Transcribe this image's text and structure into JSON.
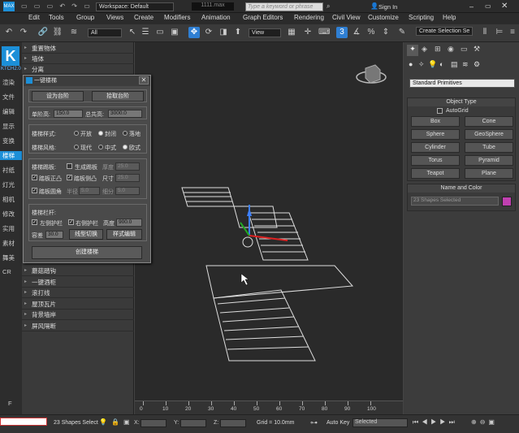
{
  "window": {
    "workspace": "Workspace: Default",
    "filename": "1111.max",
    "search_placeholder": "Type a keyword or phrase",
    "sign_in": "Sign In"
  },
  "menu": [
    "Edit",
    "Tools",
    "Group",
    "Views",
    "Create",
    "Modifiers",
    "Animation",
    "Graph Editors",
    "Rendering",
    "Civil View",
    "Customize",
    "Scripting",
    "Help"
  ],
  "toolbar": {
    "filter": "All",
    "view": "View",
    "selection_set": "Create Selection Se"
  },
  "left_nav": {
    "version": "KTCH2.0",
    "items": [
      "渲染",
      "文件",
      "编辑",
      "显示",
      "变换",
      "楼梯",
      "衬纸",
      "灯光",
      "相机",
      "修改",
      "实用",
      "素材",
      "舞美",
      "CR"
    ],
    "selected": "楼梯",
    "footer": "F"
  },
  "plugin_panel": {
    "top_items": [
      "重置物体",
      "墙体",
      "分离"
    ],
    "bottom_items": [
      "蘑菇踏钩",
      "一键酒柜",
      "滚打线",
      "屋顶瓦片",
      "背景墙岸",
      "屏风隔断"
    ]
  },
  "dialog": {
    "title": "一键楼梯",
    "btn_stairs": "设为台阶",
    "btn_pickup": "拾取台阶",
    "step_height_label": "单阶高:",
    "step_height": "150.0",
    "total_height_label": "总共高:",
    "total_height": "3000.0",
    "stair_style_label": "楼梯样式:",
    "stair_style_options": [
      "开放",
      "封闭",
      "落地"
    ],
    "stair_style_selected": "封闭",
    "stair_kind_label": "楼梯风格:",
    "stair_kind_options": [
      "现代",
      "中式",
      "欧式"
    ],
    "stair_kind_selected": "欧式",
    "kickboard_label": "楼梯踢板:",
    "kickboard_opt": "生成踢板",
    "thickness_label": "厚度",
    "thickness": "25.0",
    "tread_front": "踏板正凸",
    "tread_side": "踏板侧凸",
    "size_label": "尺寸",
    "size": "25.0",
    "tread_round": "踏板圆角",
    "radius_label": "半径",
    "radius": "5.0",
    "segments_label": "细分",
    "segments": "5.0",
    "railing_label": "楼梯栏杆:",
    "left_rail": "左侧护栏",
    "right_rail": "右侧护栏",
    "height_label": "高度",
    "height": "900.0",
    "tolerance_label": "容差",
    "tolerance": "30.0",
    "btn_linetype": "线型切换",
    "btn_style_edit": "样式编辑",
    "btn_create": "创建楼梯"
  },
  "ruler": {
    "ticks": [
      "0",
      "10",
      "20",
      "30",
      "40",
      "50",
      "60",
      "70",
      "80",
      "90",
      "100"
    ]
  },
  "right_panel": {
    "dropdown": "Standard Primitives",
    "object_type_header": "Object Type",
    "autogrid": "AutoGrid",
    "objects": [
      "Box",
      "Cone",
      "Sphere",
      "GeoSphere",
      "Cylinder",
      "Tube",
      "Torus",
      "Pyramid",
      "Teapot",
      "Plane"
    ],
    "name_color_header": "Name and Color",
    "name_value": "23 Shapes Selected",
    "color": "#c040b0"
  },
  "status": {
    "selection": "23 Shapes Select",
    "x_label": "X:",
    "y_label": "Y:",
    "z_label": "Z:",
    "grid": "Grid = 10.0mm",
    "auto_key": "Auto Key",
    "selected": "Selected"
  },
  "colors": {
    "accent": "#1c8fd8",
    "active_tool": "#2f7fd3"
  }
}
